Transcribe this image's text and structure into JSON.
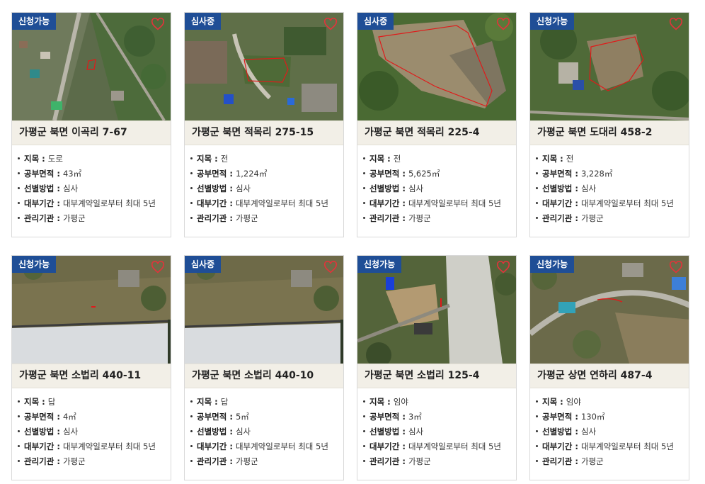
{
  "field_labels": {
    "category": "지목 :",
    "area": "공부면적 :",
    "selection": "선별방법 :",
    "lease": "대부기간 :",
    "agency": "관리기관 :"
  },
  "icons": {
    "favorite": "heart-outline-icon"
  },
  "colors": {
    "badge": "#1f4e96",
    "title_bg": "#f2efe7",
    "heart": "#e0343b",
    "parcel_outline": "#e01a1a"
  },
  "cards": [
    {
      "status": "신청가능",
      "title": "가평군 북면 이곡리 7-67",
      "category": "도로",
      "area": "43㎡",
      "selection": "심사",
      "lease": "대부계약일로부터 최대 5년",
      "agency": "가평군"
    },
    {
      "status": "심사중",
      "title": "가평군 북면 적목리 275-15",
      "category": "전",
      "area": "1,224㎡",
      "selection": "심사",
      "lease": "대부계약일로부터 최대 5년",
      "agency": "가평군"
    },
    {
      "status": "심사중",
      "title": "가평군 북면 적목리 225-4",
      "category": "전",
      "area": "5,625㎡",
      "selection": "심사",
      "lease": "대부계약일로부터 최대 5년",
      "agency": "가평군"
    },
    {
      "status": "신청가능",
      "title": "가평군 북면 도대리 458-2",
      "category": "전",
      "area": "3,228㎡",
      "selection": "심사",
      "lease": "대부계약일로부터 최대 5년",
      "agency": "가평군"
    },
    {
      "status": "신청가능",
      "title": "가평군 북면 소법리 440-11",
      "category": "답",
      "area": "4㎡",
      "selection": "심사",
      "lease": "대부계약일로부터 최대 5년",
      "agency": "가평군"
    },
    {
      "status": "심사중",
      "title": "가평군 북면 소법리 440-10",
      "category": "답",
      "area": "5㎡",
      "selection": "심사",
      "lease": "대부계약일로부터 최대 5년",
      "agency": "가평군"
    },
    {
      "status": "신청가능",
      "title": "가평군 북면 소법리 125-4",
      "category": "임야",
      "area": "3㎡",
      "selection": "심사",
      "lease": "대부계약일로부터 최대 5년",
      "agency": "가평군"
    },
    {
      "status": "신청가능",
      "title": "가평군 상면 연하리 487-4",
      "category": "임야",
      "area": "130㎡",
      "selection": "심사",
      "lease": "대부계약일로부터 최대 5년",
      "agency": "가평군"
    }
  ]
}
